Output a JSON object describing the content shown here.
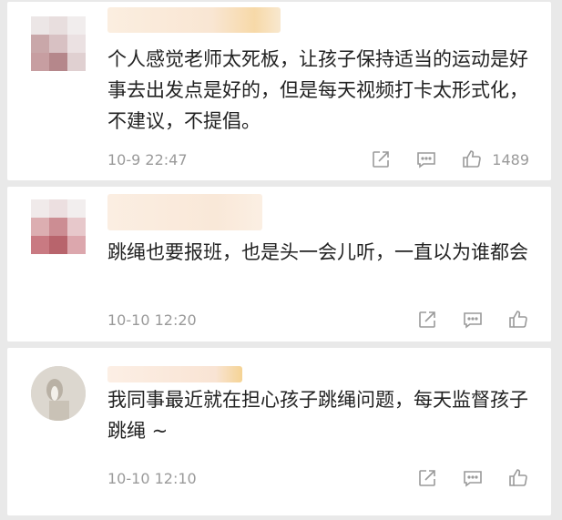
{
  "comments": [
    {
      "text": "个人感觉老师太死板，让孩子保持适当的运动是好事去出发点是好的，但是每天视频打卡太形式化，不建议，不提倡。",
      "time": "10-9 22:47",
      "likes": "1489",
      "avatar_colors": [
        "#ece6e6",
        "#e8dede",
        "#f1eded",
        "#c9a7a9",
        "#d8c1c3",
        "#ebe1e2",
        "#c79ea1",
        "#b5878b",
        "#e0d0d1"
      ]
    },
    {
      "text": "跳绳也要报班，也是头一会儿听，一直以为谁都会",
      "time": "10-10 12:20",
      "likes": "",
      "avatar_colors": [
        "#f0eaea",
        "#ecdfe0",
        "#f2eeee",
        "#dcaeb1",
        "#cc8d93",
        "#e7c8cb",
        "#c97a82",
        "#b8646c",
        "#dca7ad"
      ]
    },
    {
      "text": "我同事最近就在担心孩子跳绳问题，每天监督孩子跳绳 ~",
      "time": "10-10 12:10",
      "likes": "",
      "avatar_colors": []
    }
  ],
  "icons": {
    "share": "share-icon",
    "reply": "comment-icon",
    "like": "thumb-up-icon"
  }
}
